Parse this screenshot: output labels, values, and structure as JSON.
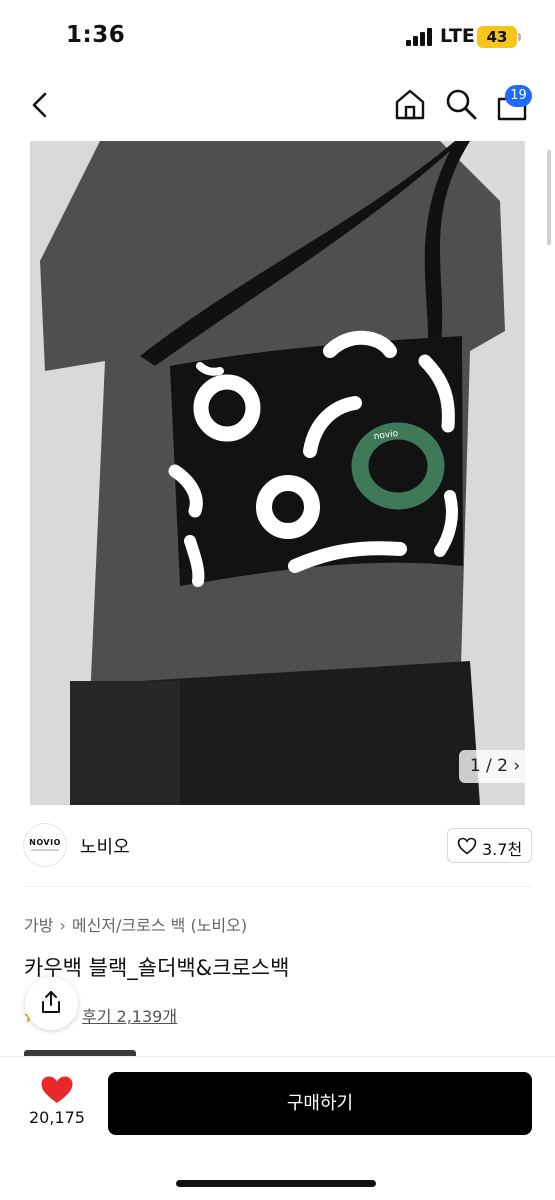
{
  "status_bar": {
    "time": "1:36",
    "network": "LTE",
    "battery": "43"
  },
  "nav": {
    "cart_badge": "19"
  },
  "product_image": {
    "counter": "1 / 2 ›",
    "bag_logo_text": "novio"
  },
  "brand": {
    "logo_text": "NOVIO",
    "name": "노비오",
    "like_count": "3.7천"
  },
  "breadcrumb": [
    "가방",
    "메신저/크로스 백 (노비오)"
  ],
  "product": {
    "title": "카우백 블랙_숄더백&크로스백",
    "reviews": "후기 2,139개"
  },
  "bottom_bar": {
    "wish_count": "20,175",
    "buy_label": "구매하기"
  },
  "colors": {
    "accent": "#1f6bff",
    "heart": "#e8282b",
    "button": "#000000",
    "bag_green": "#3f7a58"
  }
}
